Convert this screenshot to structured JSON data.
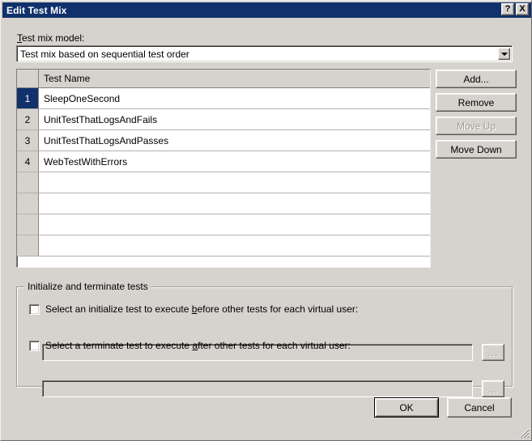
{
  "window": {
    "title": "Edit Test Mix",
    "help_button_label": "?",
    "close_button_label": "X",
    "background_color": "#d6d3ce",
    "titlebar_color": "#10316b",
    "selection_color": "#10316b"
  },
  "test_mix_model": {
    "label_prefix": "",
    "label_accel": "T",
    "label_suffix": "est mix model:",
    "selected_value": "Test mix based on sequential test order"
  },
  "grid": {
    "columns": [
      "",
      "Test Name"
    ],
    "header_row_number": "",
    "header_test_name": "Test Name",
    "rows": [
      {
        "number": "1",
        "name": "SleepOneSecond",
        "selected": true
      },
      {
        "number": "2",
        "name": "UnitTestThatLogsAndFails",
        "selected": false
      },
      {
        "number": "3",
        "name": "UnitTestThatLogsAndPasses",
        "selected": false
      },
      {
        "number": "4",
        "name": "WebTestWithErrors",
        "selected": false
      }
    ],
    "empty_row_count": 4
  },
  "side_buttons": [
    {
      "label": "Add...",
      "enabled": true,
      "name": "add-button"
    },
    {
      "label": "Remove",
      "enabled": true,
      "name": "remove-button"
    },
    {
      "label": "Move Up",
      "enabled": false,
      "name": "move-up-button"
    },
    {
      "label": "Move Down",
      "enabled": true,
      "name": "move-down-button"
    }
  ],
  "init_terminate_group": {
    "legend": "Initialize and terminate tests",
    "initialize": {
      "checked": false,
      "label_before_accel": "Select an initialize test to execute ",
      "label_accel": "b",
      "label_after_accel": "efore other tests for each virtual user:",
      "field_value": "",
      "field_enabled": false,
      "browse_label": "...",
      "browse_enabled": false
    },
    "terminate": {
      "checked": false,
      "label_before_accel": "Select a terminate test to execute ",
      "label_accel": "a",
      "label_after_accel": "fter other tests for each virtual user:",
      "field_value": "",
      "field_enabled": false,
      "browse_label": "...",
      "browse_enabled": false
    }
  },
  "footer": {
    "ok_label": "OK",
    "cancel_label": "Cancel"
  }
}
